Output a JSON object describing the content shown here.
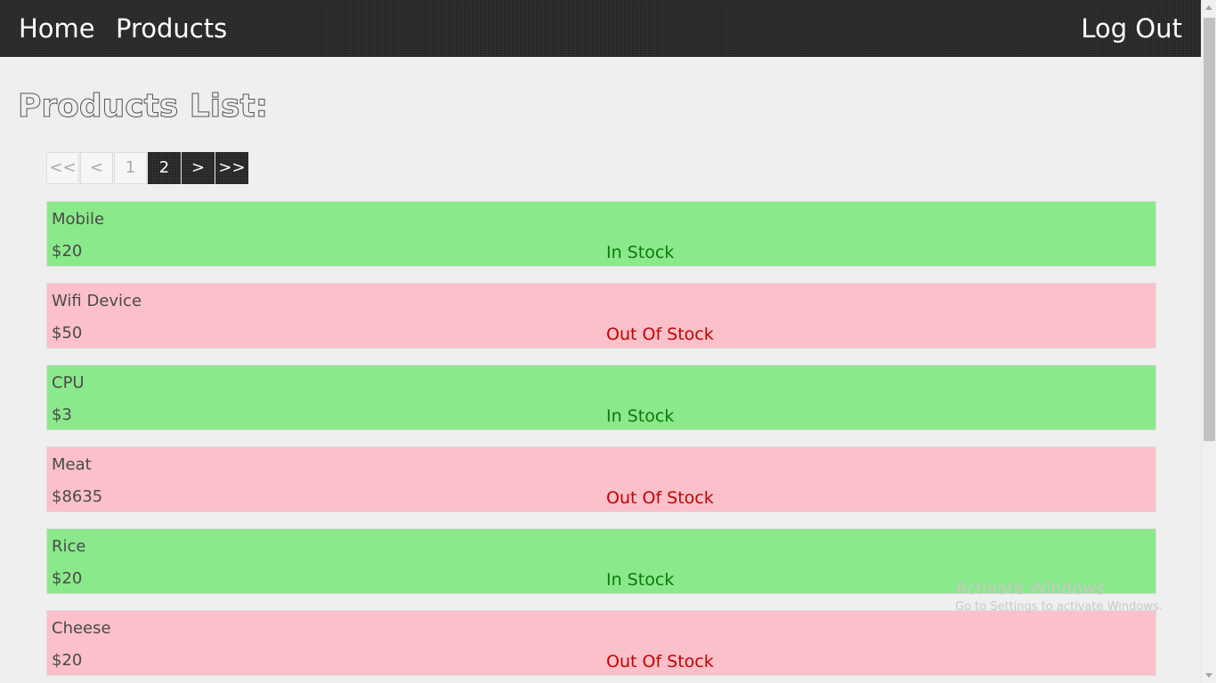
{
  "nav": {
    "home": "Home",
    "products": "Products",
    "logout": "Log Out"
  },
  "page_title": "Products List:",
  "pagination": {
    "first": "<<",
    "prev": "<",
    "page1": "1",
    "page2": "2",
    "next": ">",
    "last": ">>"
  },
  "products": [
    {
      "name": "Mobile",
      "price": "$20",
      "status": "In Stock"
    },
    {
      "name": "Wifi Device",
      "price": "$50",
      "status": "Out Of Stock"
    },
    {
      "name": "CPU",
      "price": "$3",
      "status": "In Stock"
    },
    {
      "name": "Meat",
      "price": "$8635",
      "status": "Out Of Stock"
    },
    {
      "name": "Rice",
      "price": "$20",
      "status": "In Stock"
    },
    {
      "name": "Cheese",
      "price": "$20",
      "status": "Out Of Stock"
    }
  ],
  "watermark": {
    "title": "Activate Windows",
    "subtitle": "Go to Settings to activate Windows."
  },
  "colors": {
    "navbar": "#262626",
    "in_stock_bg": "#8ae98a",
    "out_stock_bg": "#fbc0c9",
    "in_stock_text": "#0a7a0a",
    "out_stock_text": "#c40000"
  }
}
